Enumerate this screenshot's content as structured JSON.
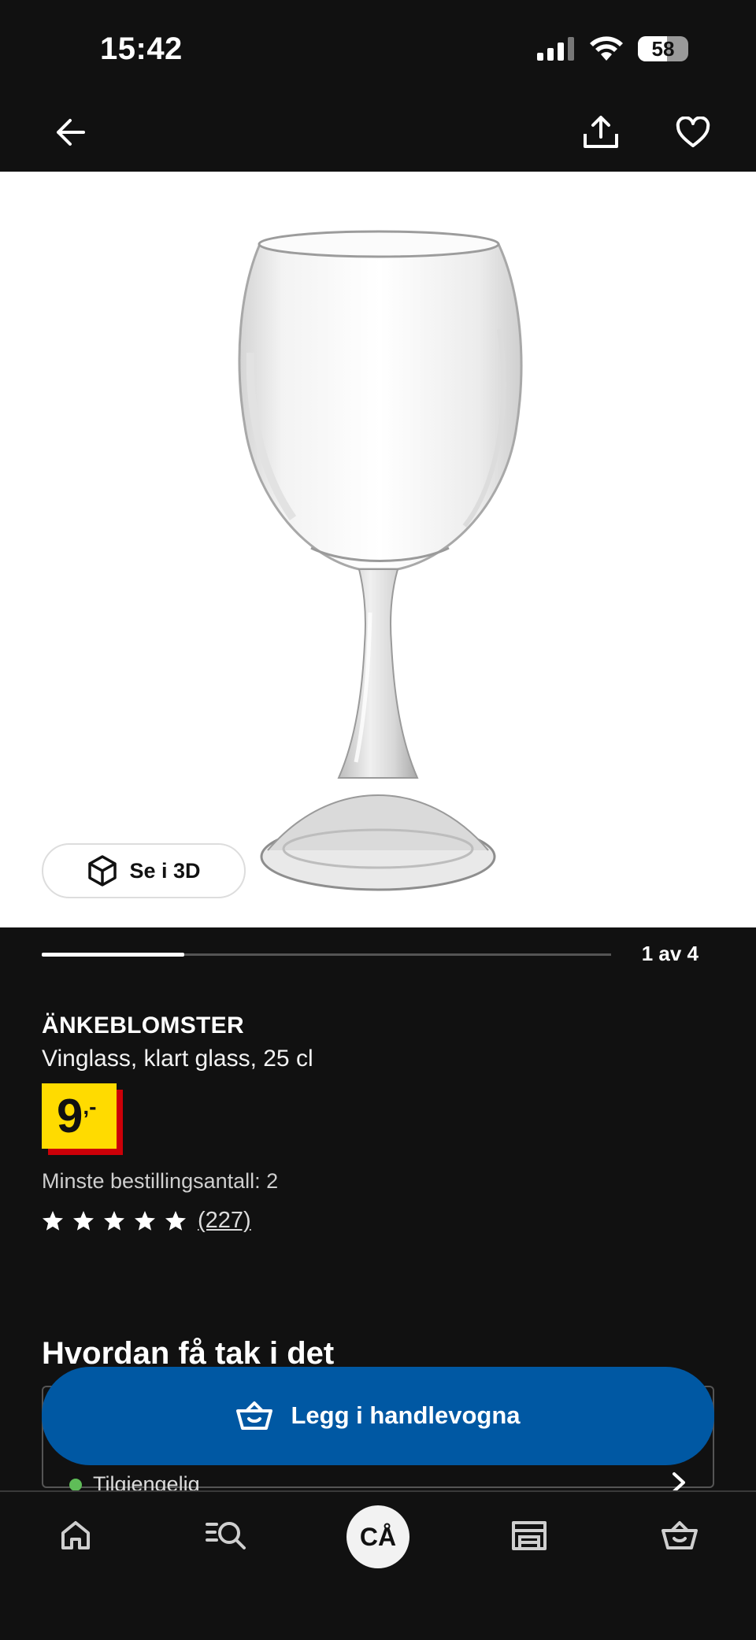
{
  "status_bar": {
    "time": "15:42",
    "battery_level": "58"
  },
  "nav": {
    "back_icon": "arrow-left-icon",
    "share_icon": "share-icon",
    "favorite_icon": "heart-icon"
  },
  "gallery": {
    "view_3d_label": "Se i 3D",
    "counter": "1 av 4",
    "progress_fraction": 0.25
  },
  "product": {
    "name": "ÄNKEBLOMSTER",
    "description": "Vinglass, klart glass, 25 cl",
    "price": "9",
    "price_suffix": ",-",
    "min_order": "Minste bestillingsantall: 2",
    "rating_stars": 5,
    "review_count": "(227)"
  },
  "availability": {
    "title": "Hvordan få tak i det",
    "status": "Tilgjengelig",
    "status_color": "#5fbd58"
  },
  "cart_button": {
    "label": "Legg i handlevogna",
    "color": "#0058a3"
  },
  "tabbar": {
    "items": [
      "home-icon",
      "search-list-icon",
      "ca-profile",
      "store-icon",
      "basket-icon"
    ],
    "center_label": "CÅ"
  },
  "colors": {
    "price_yellow": "#ffdb00",
    "price_red": "#cc0008",
    "background": "#111111"
  }
}
